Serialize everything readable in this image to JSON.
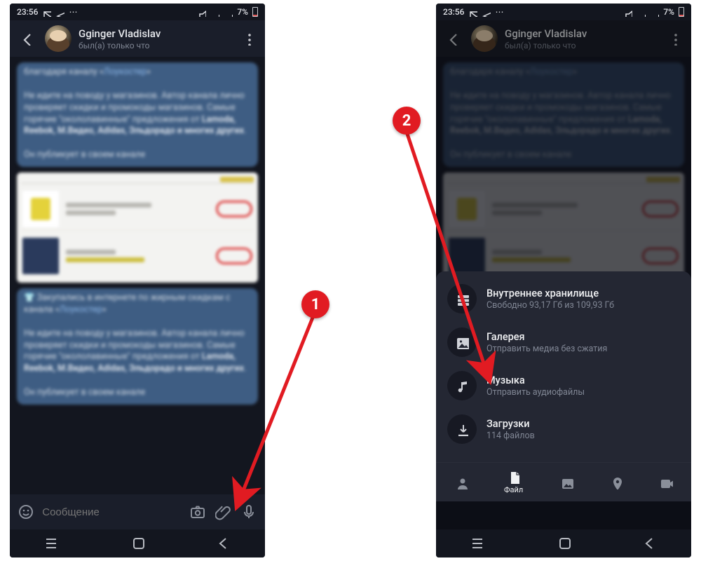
{
  "status": {
    "time": "23:56",
    "battery": "7%"
  },
  "chat": {
    "title": "Gginger Vladislav",
    "subtitle": "был(а) только что"
  },
  "input": {
    "placeholder": "Сообщение"
  },
  "sheet": {
    "items": [
      {
        "icon": "storage",
        "title": "Внутреннее хранилище",
        "sub": "Свободно 93,17 Гб из 109,93 Гб"
      },
      {
        "icon": "gallery",
        "title": "Галерея",
        "sub": "Отправить медиа без сжатия"
      },
      {
        "icon": "music",
        "title": "Музыка",
        "sub": "Отправить аудиофайлы"
      },
      {
        "icon": "download",
        "title": "Загрузки",
        "sub": "114 файлов"
      }
    ],
    "tabs": {
      "contact": "",
      "file": "Файл",
      "gallery": "",
      "location": "",
      "video": ""
    }
  },
  "annotations": {
    "step1": "1",
    "step2": "2"
  }
}
